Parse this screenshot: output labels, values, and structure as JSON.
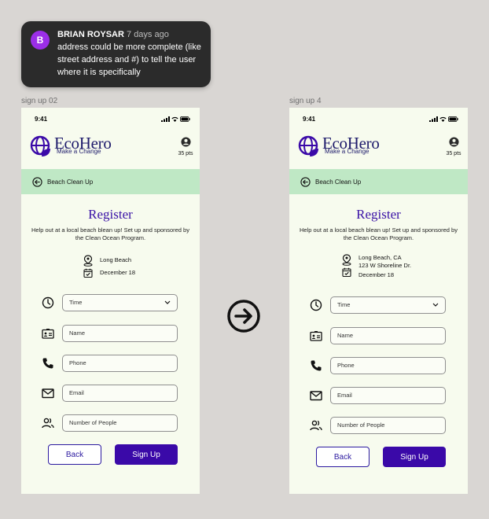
{
  "comment": {
    "avatar_letter": "B",
    "author": "BRIAN ROYSAR",
    "time": "7 days ago",
    "text": "address could be more complete (like street address and #) to tell the user where it is specifically"
  },
  "frames": [
    {
      "label": "sign up 02",
      "status_time": "9:41",
      "brand_name": "EcoHero",
      "brand_tag": "Make a Change",
      "points": "35 pts",
      "nav_title": "Beach Clean Up",
      "heading": "Register",
      "description": "Help out at a local beach blean up! Set up and sponsored by the Clean Ocean Program.",
      "location_lines": [
        "Long Beach"
      ],
      "date": "December 18",
      "fields": {
        "time": "Time",
        "name": "Name",
        "phone": "Phone",
        "email": "Email",
        "people": "Number of People"
      },
      "back_label": "Back",
      "signup_label": "Sign Up"
    },
    {
      "label": "sign up 4",
      "status_time": "9:41",
      "brand_name": "EcoHero",
      "brand_tag": "Make a Change",
      "points": "35 pts",
      "nav_title": "Beach Clean Up",
      "heading": "Register",
      "description": "Help out at a local beach blean up! Set up and sponsored by the Clean Ocean Program.",
      "location_lines": [
        "Long Beach, CA",
        "123 W Shoreline Dr."
      ],
      "date": "December 18",
      "fields": {
        "time": "Time",
        "name": "Name",
        "phone": "Phone",
        "email": "Email",
        "people": "Number of People"
      },
      "back_label": "Back",
      "signup_label": "Sign Up"
    }
  ],
  "icons": {
    "comment_avatar": "avatar",
    "transition": "arrow-right-circle-icon",
    "brand": "globe-leaf-icon",
    "user": "user-circle-icon",
    "back": "arrow-left-circle-icon",
    "location": "map-pin-icon",
    "calendar": "calendar-check-icon",
    "clock": "clock-icon",
    "id_card": "id-card-icon",
    "phone": "phone-icon",
    "mail": "mail-icon",
    "people": "people-icon",
    "chevron": "chevron-down-icon"
  },
  "colors": {
    "background": "#d9d6d3",
    "phone_bg": "#f7fbee",
    "nav_bg": "#bfe8c5",
    "brand_purple": "#3a09a8",
    "comment_bg": "#2b2b2b",
    "avatar_bg": "#9b2ee8"
  }
}
